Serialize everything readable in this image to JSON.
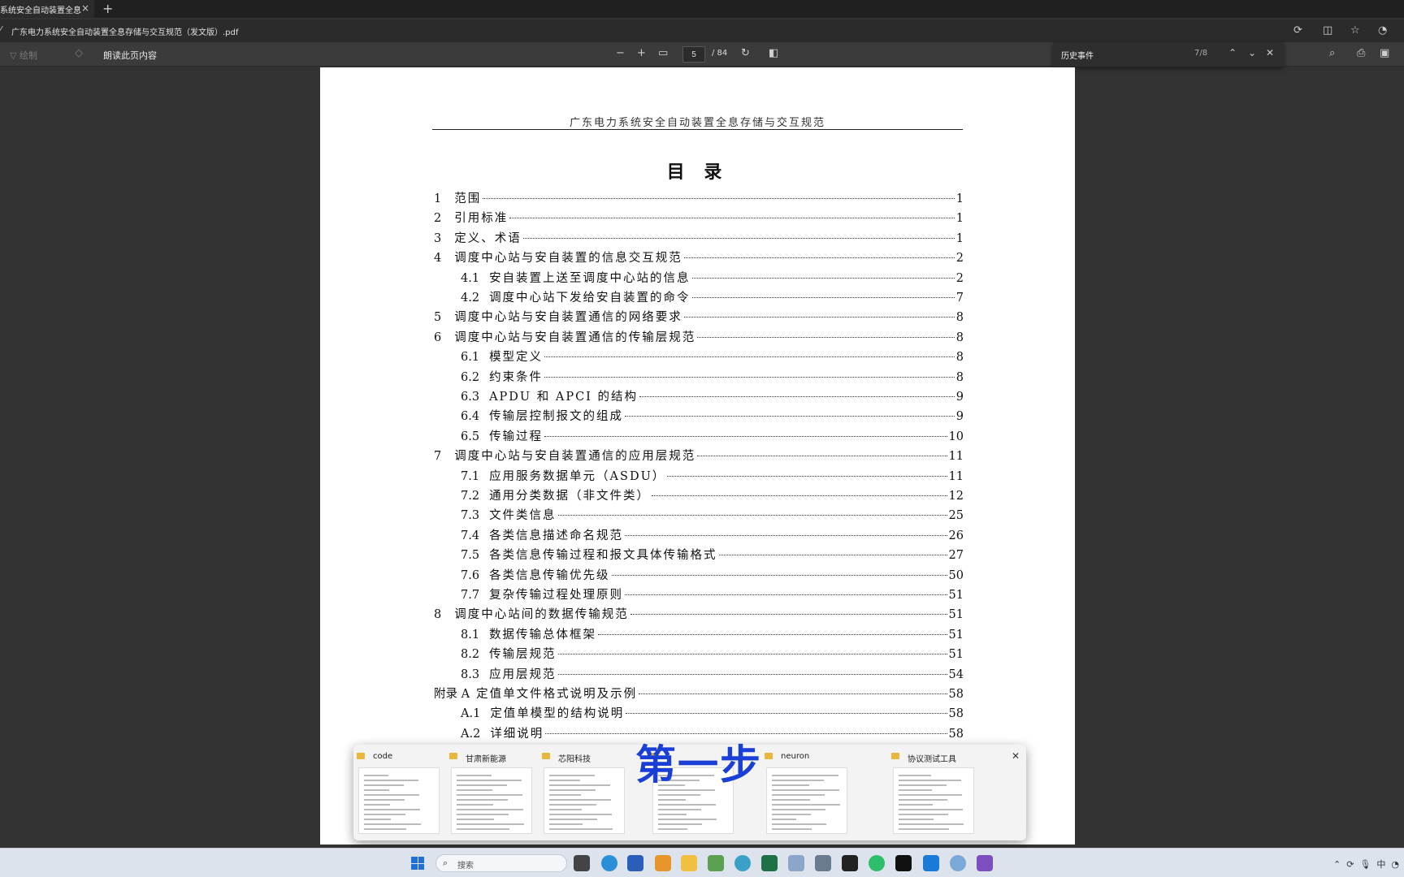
{
  "browser": {
    "tab_title": "系统安全自动装置全息存",
    "new_tab": "+",
    "tab_close": "×",
    "address": "广东电力系统安全自动装置全息存储与交互规范（发文版）.pdf"
  },
  "pdf_toolbar": {
    "draw_label": "绘制",
    "read_aloud_label": "朗读此页内容",
    "current_page": "5",
    "total_pages": "/ 84"
  },
  "find_bar": {
    "query": "历史事件",
    "count": "7/8"
  },
  "document": {
    "running_header": "广东电力系统安全自动装置全息存储与交互规范",
    "toc_title": "目 录",
    "toc": [
      {
        "num": "1",
        "title": "范围",
        "page": "1",
        "level": 1
      },
      {
        "num": "2",
        "title": "引用标准",
        "page": "1",
        "level": 1
      },
      {
        "num": "3",
        "title": "定义、术语",
        "page": "1",
        "level": 1
      },
      {
        "num": "4",
        "title": "调度中心站与安自装置的信息交互规范",
        "page": "2",
        "level": 1
      },
      {
        "num": "4.1",
        "title": "安自装置上送至调度中心站的信息",
        "page": "2",
        "level": 2
      },
      {
        "num": "4.2",
        "title": "调度中心站下发给安自装置的命令",
        "page": "7",
        "level": 2
      },
      {
        "num": "5",
        "title": "调度中心站与安自装置通信的网络要求",
        "page": "8",
        "level": 1
      },
      {
        "num": "6",
        "title": "调度中心站与安自装置通信的传输层规范",
        "page": "8",
        "level": 1
      },
      {
        "num": "6.1",
        "title": "模型定义",
        "page": "8",
        "level": 2
      },
      {
        "num": "6.2",
        "title": "约束条件",
        "page": "8",
        "level": 2
      },
      {
        "num": "6.3",
        "title": "APDU 和 APCI 的结构",
        "page": "9",
        "level": 2
      },
      {
        "num": "6.4",
        "title": "传输层控制报文的组成",
        "page": "9",
        "level": 2
      },
      {
        "num": "6.5",
        "title": "传输过程",
        "page": "10",
        "level": 2
      },
      {
        "num": "7",
        "title": "调度中心站与安自装置通信的应用层规范",
        "page": "11",
        "level": 1
      },
      {
        "num": "7.1",
        "title": "应用服务数据单元（ASDU）",
        "page": "11",
        "level": 2
      },
      {
        "num": "7.2",
        "title": "通用分类数据（非文件类）",
        "page": "12",
        "level": 2
      },
      {
        "num": "7.3",
        "title": "文件类信息",
        "page": "25",
        "level": 2
      },
      {
        "num": "7.4",
        "title": "各类信息描述命名规范",
        "page": "26",
        "level": 2
      },
      {
        "num": "7.5",
        "title": "各类信息传输过程和报文具体传输格式",
        "page": "27",
        "level": 2
      },
      {
        "num": "7.6",
        "title": "各类信息传输优先级",
        "page": "50",
        "level": 2
      },
      {
        "num": "7.7",
        "title": "复杂传输过程处理原则",
        "page": "51",
        "level": 2
      },
      {
        "num": "8",
        "title": "调度中心站间的数据传输规范",
        "page": "51",
        "level": 1
      },
      {
        "num": "8.1",
        "title": "数据传输总体框架",
        "page": "51",
        "level": 2
      },
      {
        "num": "8.2",
        "title": "传输层规范",
        "page": "51",
        "level": 2
      },
      {
        "num": "8.3",
        "title": "应用层规范",
        "page": "54",
        "level": 2
      },
      {
        "num": "附录 A",
        "title": "定值单文件格式说明及示例",
        "page": "58",
        "level": 1
      },
      {
        "num": "A.1",
        "title": "定值单模型的结构说明",
        "page": "58",
        "level": 2
      },
      {
        "num": "A.2",
        "title": "详细说明",
        "page": "58",
        "level": 2
      }
    ]
  },
  "taskbar_preview": {
    "windows": [
      "code",
      "甘肃新能源",
      "芯阳科技",
      "",
      "neuron",
      "协议测试工具"
    ],
    "overlay_text": "第一步"
  },
  "taskbar": {
    "search_placeholder": "搜索",
    "ime": "中"
  }
}
